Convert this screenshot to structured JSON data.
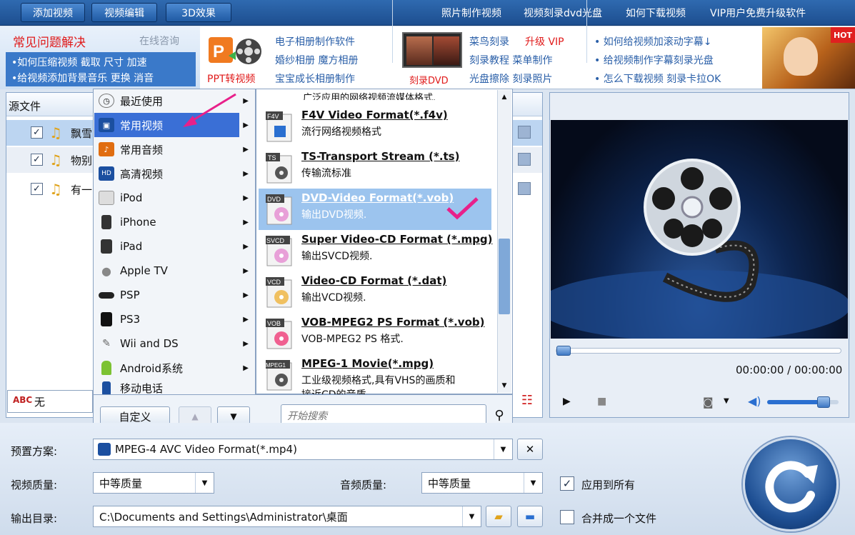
{
  "toolbar": {
    "add_video": "添加视频",
    "edit_video": "视频编辑",
    "effect_3d": "3D效果",
    "links": [
      "照片制作视频",
      "视频刻录dvd光盘",
      "如何下载视频",
      "VIP用户免费升级软件"
    ]
  },
  "ads": {
    "faq_title": "常见问题解决",
    "online_consult": "在线咨询",
    "faq_line1": "•如何压缩视频 截取 尺寸 加速",
    "faq_line2": "•给视频添加背景音乐 更换 消音",
    "ppt_label": "PPT转视频",
    "album_lines": [
      "电子相册制作软件",
      "婚纱相册 魔方相册",
      "宝宝成长相册制作"
    ],
    "dvd_label": "刻录DVD",
    "burn_line1a": "菜鸟刻录",
    "burn_line1b": "升级 VIP",
    "burn_line2": "刻录教程 菜单制作",
    "burn_line3": "光盘擦除 刻录照片",
    "tips": [
      "• 如何给视频加滚动字幕↓",
      "• 给视频制作字幕刻录光盘",
      "• 怎么下载视频 刻录卡拉OK"
    ],
    "hot": "HOT"
  },
  "file_panel": {
    "header": "源文件",
    "rows": [
      {
        "name": "飘雪"
      },
      {
        "name": "物别"
      },
      {
        "name": "有一"
      }
    ],
    "subtitle_value": "无"
  },
  "menu": {
    "categories": [
      {
        "label": "最近使用",
        "icon": "clock-icon"
      },
      {
        "label": "常用视频",
        "icon": "video-icon"
      },
      {
        "label": "常用音频",
        "icon": "audio-icon"
      },
      {
        "label": "高清视频",
        "icon": "hd-icon"
      },
      {
        "label": "iPod",
        "icon": "ipod-icon"
      },
      {
        "label": "iPhone",
        "icon": "iphone-icon"
      },
      {
        "label": "iPad",
        "icon": "ipad-icon"
      },
      {
        "label": "Apple TV",
        "icon": "apple-icon"
      },
      {
        "label": "PSP",
        "icon": "psp-icon"
      },
      {
        "label": "PS3",
        "icon": "ps3-icon"
      },
      {
        "label": "Wii and DS",
        "icon": "wii-icon"
      },
      {
        "label": "Android系统",
        "icon": "android-icon"
      },
      {
        "label": "移动电话",
        "icon": "phone-icon"
      }
    ],
    "top_partial": "广泛应用的网络视频流媒体格式.",
    "formats": [
      {
        "badge": "F4V",
        "title": "F4V Video Format(*.f4v)",
        "desc": "流行网络视频格式"
      },
      {
        "badge": "TS",
        "title": "TS-Transport Stream (*.ts)",
        "desc": "传输流标准"
      },
      {
        "badge": "DVD",
        "title": "DVD-Video Format(*.vob)",
        "desc": "输出DVD视频."
      },
      {
        "badge": "SVCD",
        "title": "Super Video-CD Format (*.mpg)",
        "desc": "输出SVCD视频."
      },
      {
        "badge": "VCD",
        "title": "Video-CD Format (*.dat)",
        "desc": "输出VCD视频."
      },
      {
        "badge": "VOB",
        "title": "VOB-MPEG2 PS Format (*.vob)",
        "desc": "VOB-MPEG2 PS 格式."
      },
      {
        "badge": "MPEG1",
        "title": "MPEG-1 Movie(*.mpg)",
        "desc": "工业级视频格式,具有VHS的画质和"
      }
    ],
    "bottom_partial": "接近CD的音质",
    "custom_button": "自定义",
    "search_placeholder": "开始搜索"
  },
  "preview": {
    "time": "00:00:00 / 00:00:00",
    "progress": 0,
    "volume": 0.85
  },
  "settings": {
    "preset_label": "预置方案:",
    "preset_value": "MPEG-4 AVC Video Format(*.mp4)",
    "video_quality_label": "视频质量:",
    "video_quality_value": "中等质量",
    "audio_quality_label": "音频质量:",
    "audio_quality_value": "中等质量",
    "apply_all": "应用到所有",
    "output_label": "输出目录:",
    "output_value": "C:\\Documents and Settings\\Administrator\\桌面",
    "merge_label": "合并成一个文件"
  },
  "colors": {
    "toolbar": "#1d4e8f",
    "selection": "#3a6fd6",
    "highlight": "#9cc4ee",
    "checkmark": "#e8208a"
  }
}
